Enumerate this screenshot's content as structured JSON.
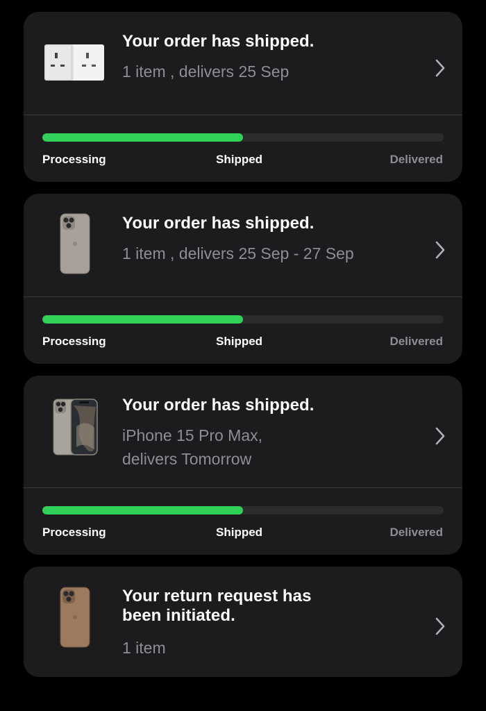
{
  "colors": {
    "background": "#000000",
    "card": "#1c1c1e",
    "progress_fill": "#30d158",
    "progress_track": "#2c2c2e",
    "secondary_text": "#8e8e93"
  },
  "orders": [
    {
      "thumbnail": "power-adapter",
      "title": "Your order has shipped.",
      "subtitle": "1 item , delivers 25 Sep",
      "progress": 0.5,
      "steps": [
        "Processing",
        "Shipped",
        "Delivered"
      ]
    },
    {
      "thumbnail": "iphone-back-titanium",
      "title": "Your order has shipped.",
      "subtitle": "1 item , delivers 25 Sep - 27 Sep",
      "progress": 0.5,
      "steps": [
        "Processing",
        "Shipped",
        "Delivered"
      ]
    },
    {
      "thumbnail": "iphone-15-pro-max",
      "title": "Your order has shipped.",
      "subtitle_line1": "iPhone 15 Pro Max,",
      "subtitle_line2": "delivers Tomorrow",
      "progress": 0.5,
      "steps": [
        "Processing",
        "Shipped",
        "Delivered"
      ]
    },
    {
      "thumbnail": "iphone-case-brown",
      "title_line1": "Your return request has",
      "title_line2": "been initiated.",
      "subtitle": "1 item"
    }
  ]
}
